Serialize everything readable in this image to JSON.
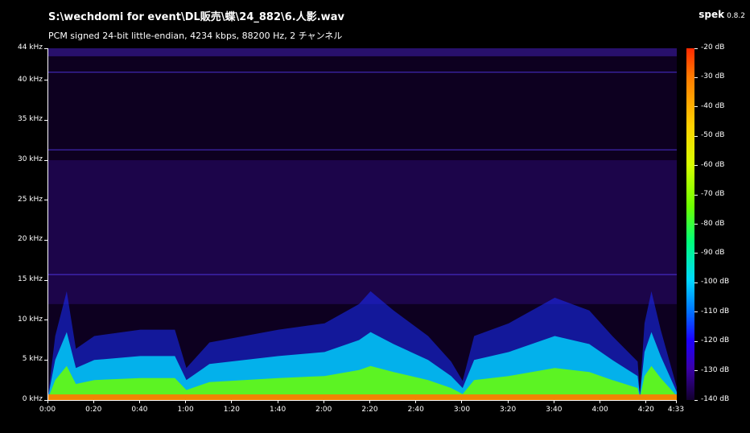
{
  "header": {
    "file_path": "S:\\wechdomi for event\\DL販売\\蝶\\24_882\\6.人影.wav",
    "stream_info": "PCM signed 24-bit little-endian, 4234 kbps, 88200 Hz, 2 チャンネル",
    "app_name": "spek",
    "app_version": "0.8.2"
  },
  "chart_data": {
    "type": "heatmap",
    "x_axis": {
      "unit": "time",
      "range": [
        0,
        273
      ],
      "ticks": [
        {
          "value": 0,
          "label": "0:00"
        },
        {
          "value": 20,
          "label": "0:20"
        },
        {
          "value": 40,
          "label": "0:40"
        },
        {
          "value": 60,
          "label": "1:00"
        },
        {
          "value": 80,
          "label": "1:20"
        },
        {
          "value": 100,
          "label": "1:40"
        },
        {
          "value": 120,
          "label": "2:00"
        },
        {
          "value": 140,
          "label": "2:20"
        },
        {
          "value": 160,
          "label": "2:40"
        },
        {
          "value": 180,
          "label": "3:00"
        },
        {
          "value": 200,
          "label": "3:20"
        },
        {
          "value": 220,
          "label": "3:40"
        },
        {
          "value": 240,
          "label": "4:00"
        },
        {
          "value": 260,
          "label": "4:20"
        },
        {
          "value": 273,
          "label": "4:33"
        }
      ]
    },
    "y_axis": {
      "unit": "kHz",
      "range": [
        0,
        44
      ],
      "ticks": [
        {
          "value": 0,
          "label": "0 kHz"
        },
        {
          "value": 5,
          "label": "5 kHz"
        },
        {
          "value": 10,
          "label": "10 kHz"
        },
        {
          "value": 15,
          "label": "15 kHz"
        },
        {
          "value": 20,
          "label": "20 kHz"
        },
        {
          "value": 25,
          "label": "25 kHz"
        },
        {
          "value": 30,
          "label": "30 kHz"
        },
        {
          "value": 35,
          "label": "35 kHz"
        },
        {
          "value": 40,
          "label": "40 kHz"
        },
        {
          "value": 44,
          "label": "44 kHz"
        }
      ]
    },
    "colorbar": {
      "unit": "dB",
      "range": [
        -140,
        -20
      ],
      "ticks": [
        {
          "value": -20,
          "label": "-20 dB"
        },
        {
          "value": -30,
          "label": "-30 dB"
        },
        {
          "value": -40,
          "label": "-40 dB"
        },
        {
          "value": -50,
          "label": "-50 dB"
        },
        {
          "value": -60,
          "label": "-60 dB"
        },
        {
          "value": -70,
          "label": "-70 dB"
        },
        {
          "value": -80,
          "label": "-80 dB"
        },
        {
          "value": -90,
          "label": "-90 dB"
        },
        {
          "value": -100,
          "label": "-100 dB"
        },
        {
          "value": -110,
          "label": "-110 dB"
        },
        {
          "value": -120,
          "label": "-120 dB"
        },
        {
          "value": -130,
          "label": "-130 dB"
        },
        {
          "value": -140,
          "label": "-140 dB"
        }
      ]
    },
    "horizontal_lines_khz": [
      15.7,
      31.3,
      41
    ],
    "energy_profile": [
      {
        "t": 0,
        "khz": 0.5
      },
      {
        "t": 3,
        "khz": 5
      },
      {
        "t": 8,
        "khz": 8.5
      },
      {
        "t": 12,
        "khz": 4
      },
      {
        "t": 20,
        "khz": 5
      },
      {
        "t": 40,
        "khz": 5.5
      },
      {
        "t": 55,
        "khz": 5.5
      },
      {
        "t": 60,
        "khz": 2.5
      },
      {
        "t": 70,
        "khz": 4.5
      },
      {
        "t": 100,
        "khz": 5.5
      },
      {
        "t": 120,
        "khz": 6
      },
      {
        "t": 135,
        "khz": 7.5
      },
      {
        "t": 140,
        "khz": 8.5
      },
      {
        "t": 150,
        "khz": 7
      },
      {
        "t": 165,
        "khz": 5
      },
      {
        "t": 175,
        "khz": 3
      },
      {
        "t": 180,
        "khz": 1.5
      },
      {
        "t": 185,
        "khz": 5
      },
      {
        "t": 200,
        "khz": 6
      },
      {
        "t": 220,
        "khz": 8
      },
      {
        "t": 235,
        "khz": 7
      },
      {
        "t": 245,
        "khz": 5
      },
      {
        "t": 256,
        "khz": 3
      },
      {
        "t": 257,
        "khz": 0.5
      },
      {
        "t": 259,
        "khz": 6
      },
      {
        "t": 262,
        "khz": 8.5
      },
      {
        "t": 266,
        "khz": 5.5
      },
      {
        "t": 273,
        "khz": 1
      }
    ],
    "colors": {
      "background": "#0d0020",
      "upper_band": "#2a0a6e",
      "mid_band": "#1a2cff",
      "low_band": "#00d8ff",
      "base_band": "#6cff00",
      "floor": "#ff7a00"
    }
  }
}
